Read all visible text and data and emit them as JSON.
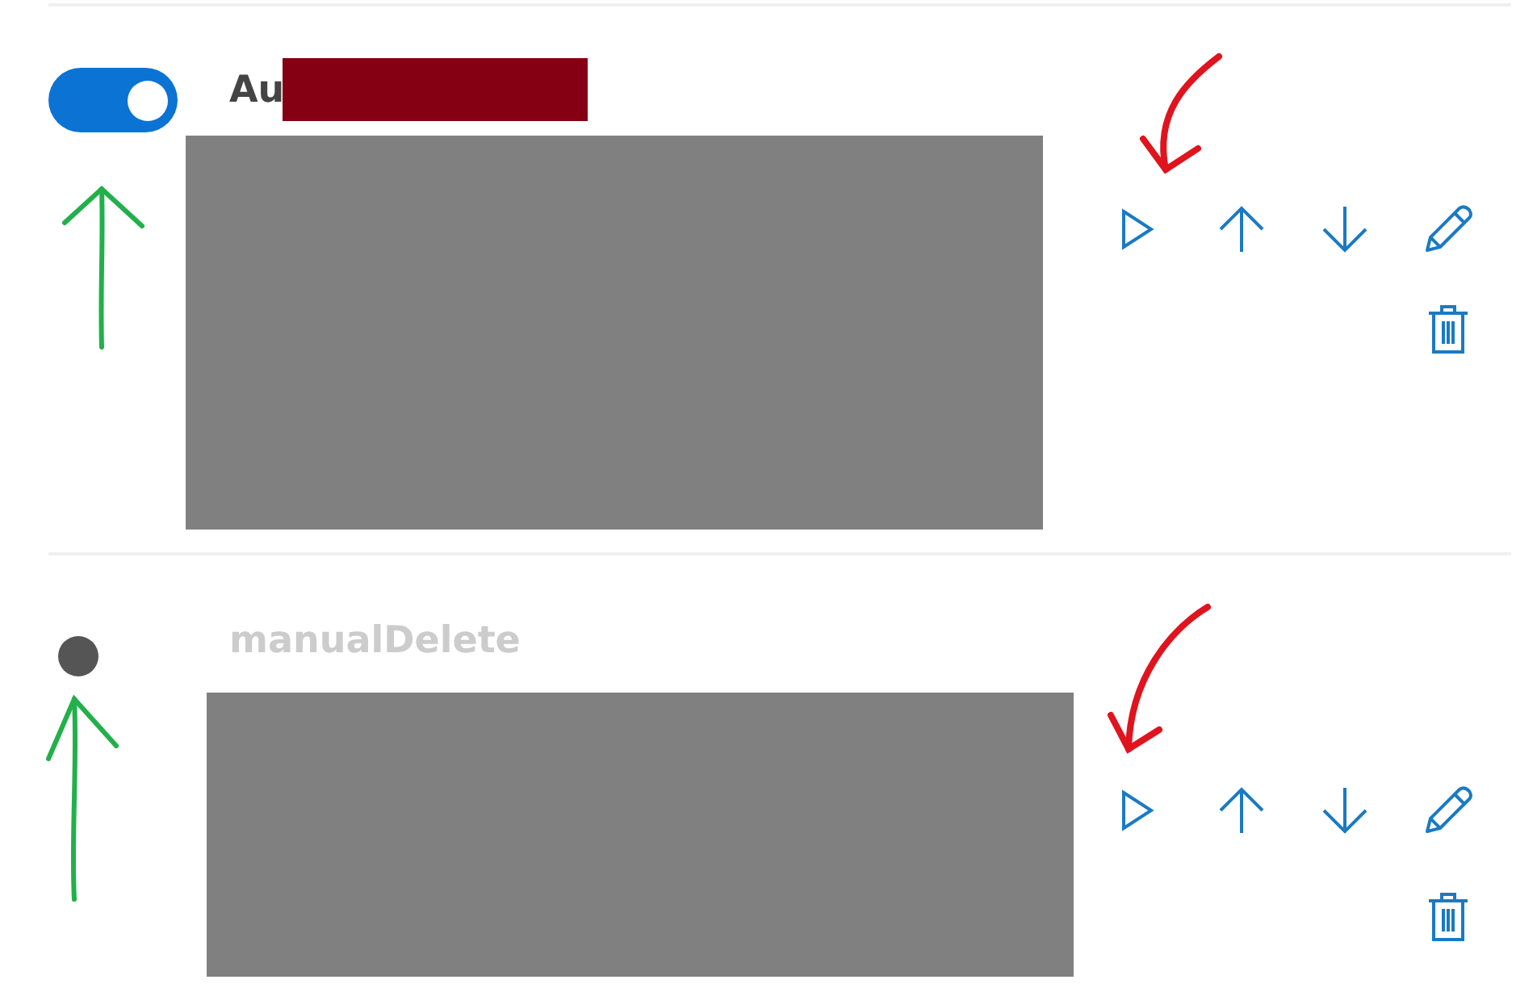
{
  "rules": [
    {
      "title": "Au",
      "enabled": true,
      "title_redacted": true
    },
    {
      "title": "manualDelete",
      "enabled": false,
      "title_redacted": false
    }
  ],
  "annotations": [
    {
      "kind": "curved",
      "color": "#e0141e"
    },
    {
      "kind": "straight",
      "color": "#22b04a"
    },
    {
      "kind": "curved",
      "color": "#e0141e"
    },
    {
      "kind": "straight",
      "color": "#22b04a"
    }
  ]
}
